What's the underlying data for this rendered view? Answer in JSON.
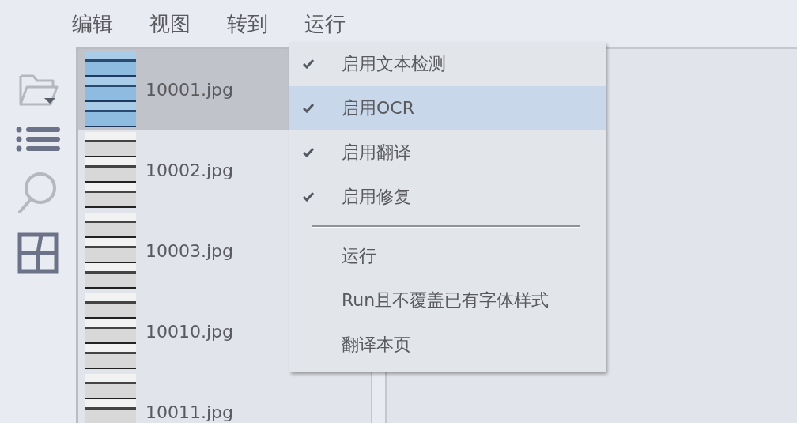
{
  "menubar": [
    {
      "label": "编辑"
    },
    {
      "label": "视图"
    },
    {
      "label": "转到"
    },
    {
      "label": "运行"
    }
  ],
  "files": [
    {
      "name": "10001.jpg",
      "selected": true
    },
    {
      "name": "10002.jpg",
      "selected": false
    },
    {
      "name": "10003.jpg",
      "selected": false
    },
    {
      "name": "10010.jpg",
      "selected": false
    },
    {
      "name": "10011.jpg",
      "selected": false
    }
  ],
  "menu": {
    "toggles": [
      {
        "label": "启用文本检测",
        "checked": true,
        "selected": false
      },
      {
        "label": "启用OCR",
        "checked": true,
        "selected": true
      },
      {
        "label": "启用翻译",
        "checked": true,
        "selected": false
      },
      {
        "label": "启用修复",
        "checked": true,
        "selected": false
      }
    ],
    "actions": [
      {
        "label": "运行",
        "selected": false
      },
      {
        "label": "Run且不覆盖已有字体样式",
        "selected": false
      },
      {
        "label": "翻译本页",
        "selected": false
      }
    ]
  }
}
